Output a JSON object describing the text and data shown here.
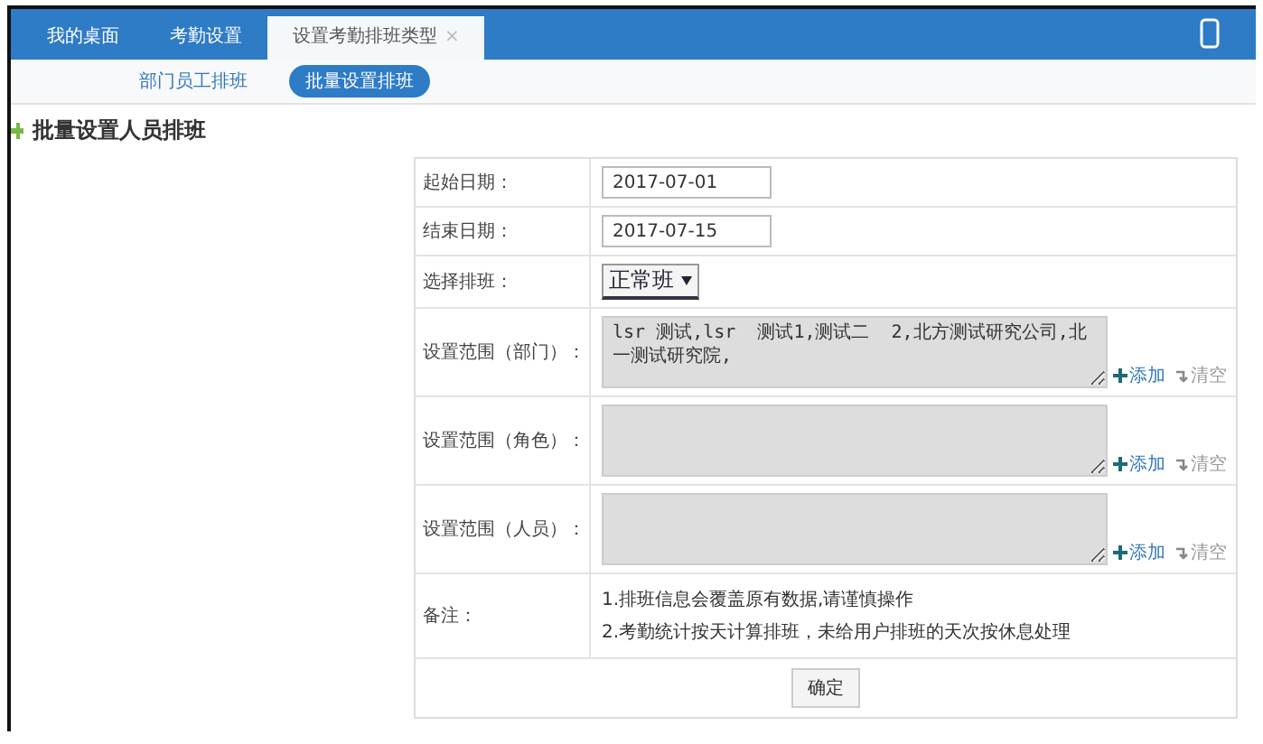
{
  "tabs": [
    {
      "label": "我的桌面",
      "selected": false
    },
    {
      "label": "考勤设置",
      "selected": false
    },
    {
      "label": "设置考勤排班类型",
      "selected": true,
      "close": "×"
    }
  ],
  "subtabs": [
    {
      "label": "部门员工排班",
      "selected": false
    },
    {
      "label": "批量设置排班",
      "selected": true
    }
  ],
  "page_title": "批量设置人员排班",
  "form": {
    "rows": [
      {
        "kind": "input",
        "label": "起始日期：",
        "value": "2017-07-01"
      },
      {
        "kind": "input",
        "label": "结束日期：",
        "value": "2017-07-15"
      },
      {
        "kind": "select",
        "label": "选择排班：",
        "value": "正常班"
      },
      {
        "kind": "textarea",
        "label": "设置范围（部门）：",
        "value": "lsr 测试,lsr  测试1,测试二  2,北方测试研究公司,北一测试研究院,",
        "add": "添加",
        "clear": "清空"
      },
      {
        "kind": "textarea",
        "label": "设置范围（角色）：",
        "add": "添加",
        "clear": "清空"
      },
      {
        "kind": "textarea",
        "label": "设置范围（人员）：",
        "add": "添加",
        "clear": "清空"
      },
      {
        "kind": "note",
        "label": "备注：",
        "lines": [
          "1.排班信息会覆盖原有数据,请谨慎操作",
          "2.考勤统计按天计算排班，未给用户排班的天次按休息处理"
        ]
      }
    ],
    "submit": "确定"
  }
}
